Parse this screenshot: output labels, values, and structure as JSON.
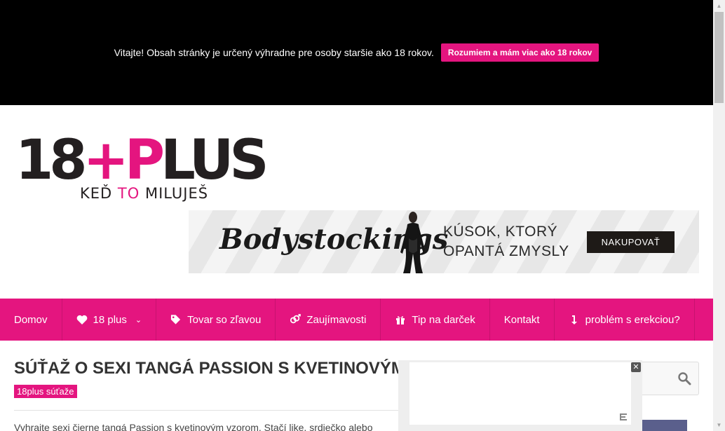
{
  "age_notice": {
    "text": "Vitajte! Obsah stránky je určený výhradne pre osoby staršie ako 18 rokov.",
    "button_label": "Rozumiem a mám viac ako 18 rokov"
  },
  "logo": {
    "main_dark_1": "18",
    "main_pink": "+P",
    "main_dark_2": "LUS",
    "tagline_1": "KEĎ",
    "tagline_pink": "TO",
    "tagline_2": "MILUJEŠ"
  },
  "banner": {
    "brand": "Bodystockings",
    "headline_line1": "KÚSOK, KTORÝ",
    "headline_line2": "OPANTÁ ZMYSLY",
    "button_label": "NAKUPOVAŤ"
  },
  "nav": {
    "items": [
      {
        "label": "Domov",
        "icon": "none"
      },
      {
        "label": "18 plus",
        "icon": "heart-icon"
      },
      {
        "label": "Tovar so zľavou",
        "icon": "tags-icon"
      },
      {
        "label": "Zaujímavosti",
        "icon": "gender-icon"
      },
      {
        "label": "Tip na darček",
        "icon": "gift-icon"
      },
      {
        "label": "Kontakt",
        "icon": "none"
      },
      {
        "label": "problém s erekciou?",
        "icon": "arrow-down-icon"
      }
    ]
  },
  "post": {
    "title": "SÚŤAŽ O SEXI TANGÁ PASSION S KVETINOVÝM",
    "category": "18plus súťaže",
    "excerpt": "Vyhrajte sexi čierne tangá Passion s kvetinovým vzorom. Stačí like, srdiečko alebo"
  },
  "colors": {
    "accent": "#e4157f",
    "dark": "#231f20",
    "top_bar": "#000000"
  }
}
